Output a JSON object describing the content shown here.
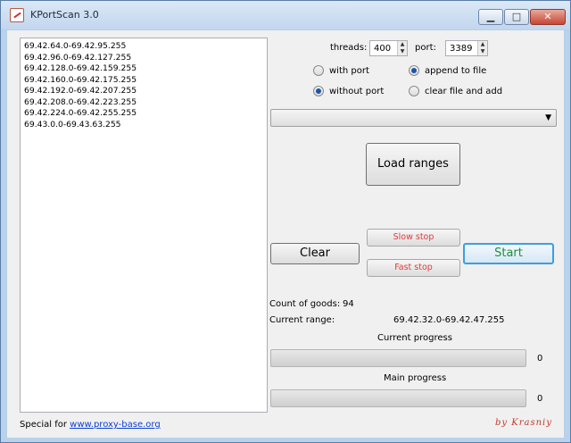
{
  "window": {
    "title": "KPortScan 3.0",
    "min_symbol": "▁",
    "max_symbol": "□",
    "close_symbol": "✕"
  },
  "ranges": [
    "69.42.64.0-69.42.95.255",
    "69.42.96.0-69.42.127.255",
    "69.42.128.0-69.42.159.255",
    "69.42.160.0-69.42.175.255",
    "69.42.192.0-69.42.207.255",
    "69.42.208.0-69.42.223.255",
    "69.42.224.0-69.42.255.255",
    "69.43.0.0-69.43.63.255"
  ],
  "settings": {
    "threads_label": "threads:",
    "threads_value": "400",
    "port_label": "port:",
    "port_value": "3389",
    "with_port_label": "with port",
    "without_port_label": "without port",
    "append_label": "append to file",
    "clear_add_label": "clear file and add",
    "port_mode_selected": "without_port",
    "file_mode_selected": "append",
    "combo_value": ""
  },
  "buttons": {
    "load": "Load ranges",
    "clear": "Clear",
    "slow_stop": "Slow stop",
    "fast_stop": "Fast stop",
    "start": "Start"
  },
  "status": {
    "goods_label": "Count of goods:",
    "goods_value": "94",
    "range_label": "Current range:",
    "range_value": "69.42.32.0-69.42.47.255",
    "current_progress_label": "Current progress",
    "current_progress_value": "0",
    "main_progress_label": "Main progress",
    "main_progress_value": "0"
  },
  "footer": {
    "special_label": "Special for",
    "link_text": "www.proxy-base.org",
    "signature": "by Krasniy"
  },
  "colors": {
    "stop_text": "#e03b3b",
    "start_text": "#1f8f3a",
    "link": "#0b3fd6",
    "signature": "#c0392b"
  }
}
